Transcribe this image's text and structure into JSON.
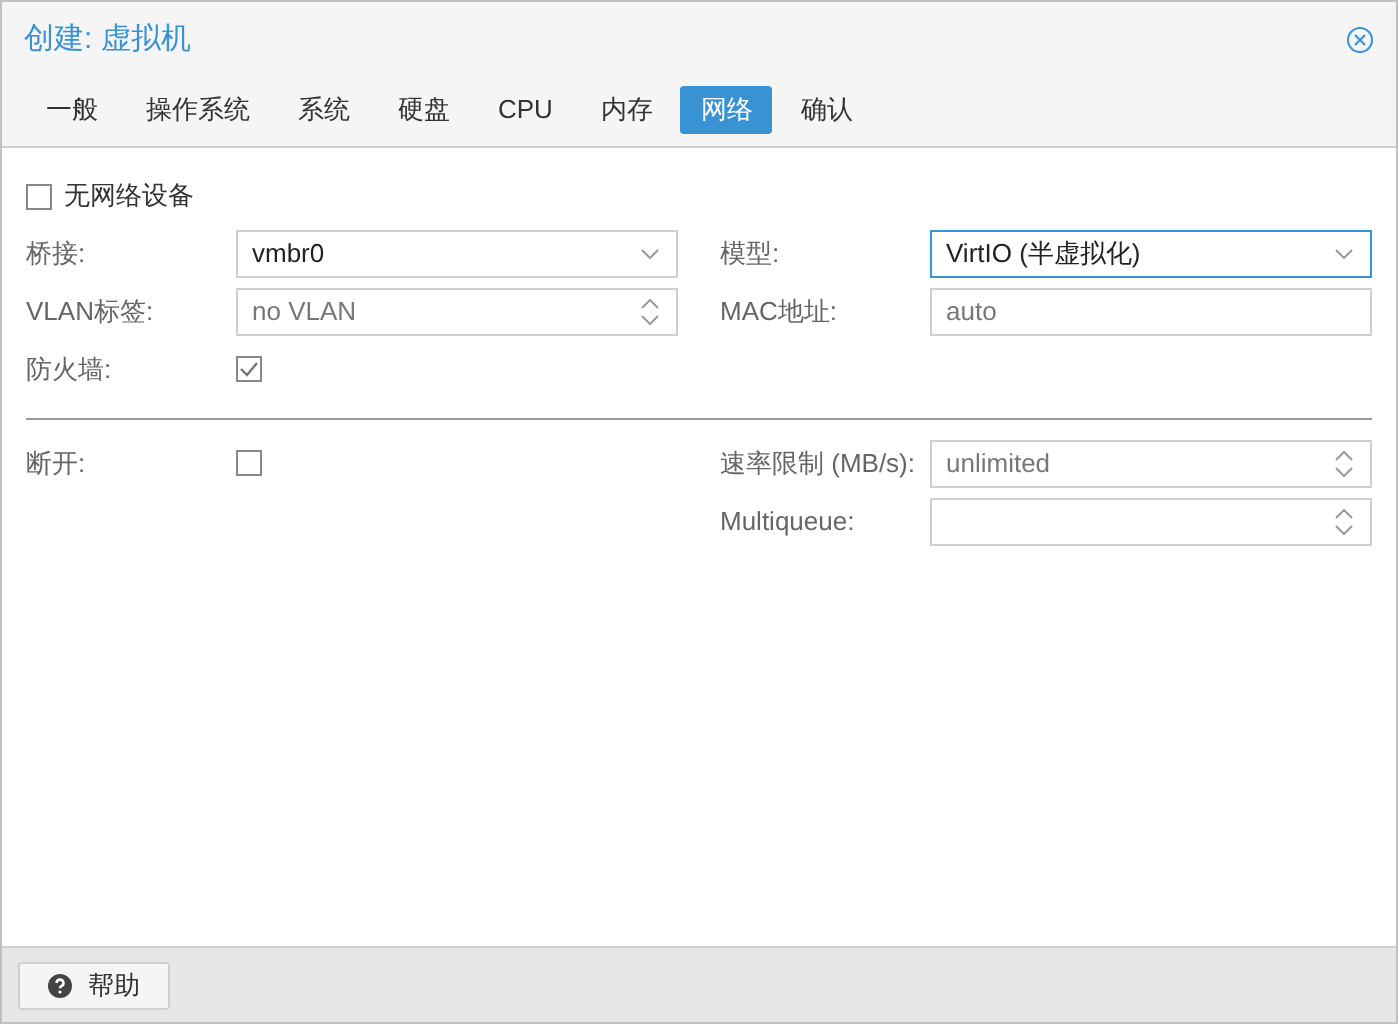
{
  "window": {
    "title": "创建: 虚拟机"
  },
  "tabs": [
    {
      "label": "一般",
      "selected": false
    },
    {
      "label": "操作系统",
      "selected": false
    },
    {
      "label": "系统",
      "selected": false
    },
    {
      "label": "硬盘",
      "selected": false
    },
    {
      "label": "CPU",
      "selected": false
    },
    {
      "label": "内存",
      "selected": false
    },
    {
      "label": "网络",
      "selected": true
    },
    {
      "label": "确认",
      "selected": false
    }
  ],
  "no_network": {
    "label": "无网络设备",
    "checked": false
  },
  "left_fields": [
    {
      "label": "桥接:",
      "kind": "combo",
      "value": "vmbr0"
    },
    {
      "label": "VLAN标签:",
      "kind": "spinner",
      "placeholder": "no VLAN"
    },
    {
      "label": "防火墙:",
      "kind": "checkbox",
      "checked": true
    }
  ],
  "right_fields": [
    {
      "label": "模型:",
      "kind": "combo",
      "value": "VirtIO (半虚拟化)",
      "focused": true
    },
    {
      "label": "MAC地址:",
      "kind": "text",
      "placeholder": "auto"
    }
  ],
  "advanced_left": [
    {
      "label": "断开:",
      "kind": "checkbox",
      "checked": false
    }
  ],
  "advanced_right": [
    {
      "label": "速率限制 (MB/s):",
      "kind": "spinner",
      "placeholder": "unlimited"
    },
    {
      "label": "Multiqueue:",
      "kind": "spinner"
    }
  ],
  "footer": {
    "help_button": "帮助"
  }
}
